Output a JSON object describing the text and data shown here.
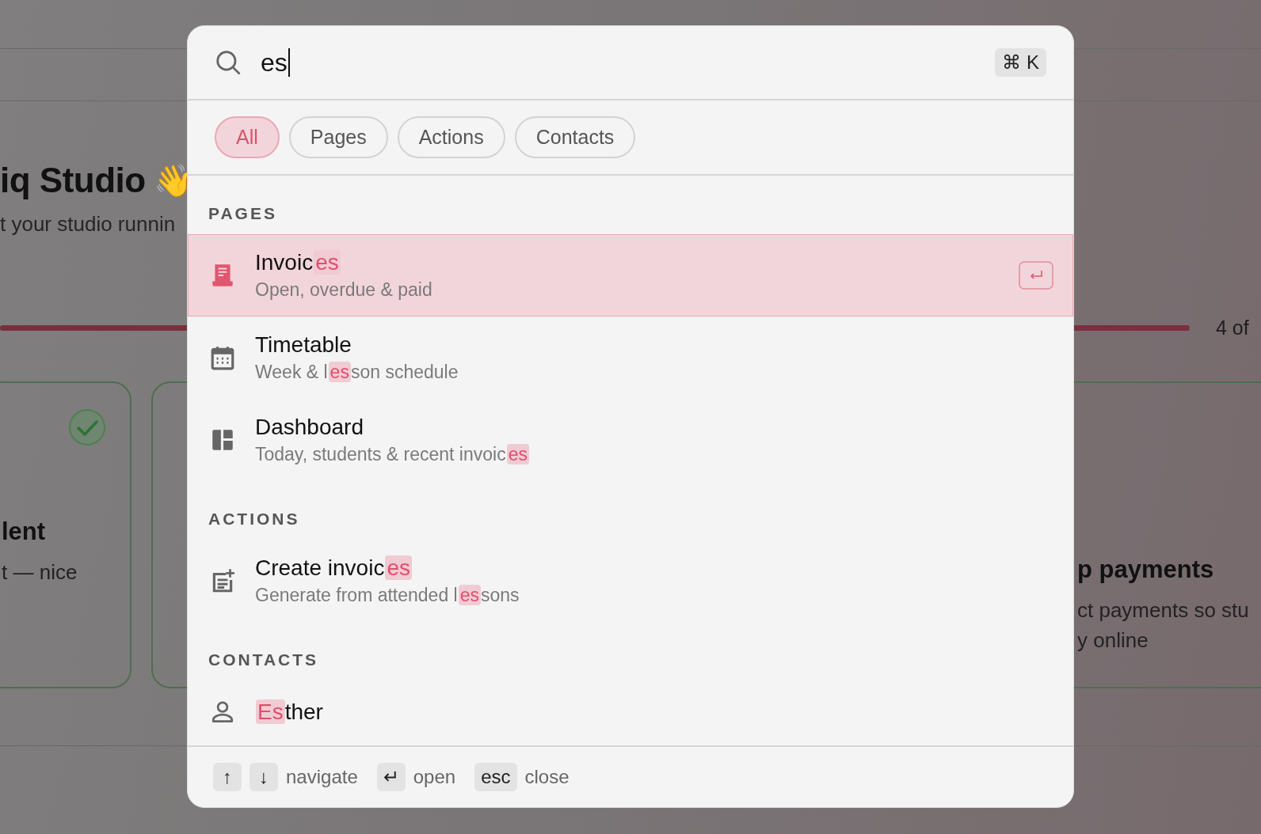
{
  "background": {
    "heading": "iq Studio",
    "heading_emoji": "👋",
    "subtitle": "t your studio runnin",
    "progress": {
      "level": 1,
      "reading": "4 of"
    },
    "cards": [
      {
        "title": "lent",
        "text": "t — nice",
        "done": true
      },
      {
        "title": "p payments",
        "lines": [
          "ct payments so stu",
          "y online"
        ]
      }
    ]
  },
  "palette": {
    "query": "es",
    "shortcut": "⌘ K",
    "filters": [
      {
        "label": "All",
        "selected": true
      },
      {
        "label": "Pages",
        "selected": false
      },
      {
        "label": "Actions",
        "selected": false
      },
      {
        "label": "Contacts",
        "selected": false
      }
    ],
    "sections": [
      {
        "label": "PAGES",
        "items": [
          {
            "kind": "receipt",
            "selected": true,
            "title": [
              {
                "text": "Invoic",
                "match": false
              },
              {
                "text": "es",
                "match": true
              }
            ],
            "subtitle": [
              {
                "text": "Open, overdue & paid",
                "match": false
              }
            ]
          },
          {
            "kind": "calendar",
            "selected": false,
            "title": [
              {
                "text": "Timetable",
                "match": false
              }
            ],
            "subtitle": [
              {
                "text": "Week & l",
                "match": false
              },
              {
                "text": "es",
                "match": true
              },
              {
                "text": "son schedule",
                "match": false
              }
            ]
          },
          {
            "kind": "dashboard",
            "selected": false,
            "title": [
              {
                "text": "Dashboard",
                "match": false
              }
            ],
            "subtitle": [
              {
                "text": "Today, students & recent invoic",
                "match": false
              },
              {
                "text": "es",
                "match": true
              }
            ]
          }
        ]
      },
      {
        "label": "ACTIONS",
        "items": [
          {
            "kind": "action",
            "selected": false,
            "title": [
              {
                "text": "Create invoic",
                "match": false
              },
              {
                "text": "es",
                "match": true
              }
            ],
            "subtitle": [
              {
                "text": "Generate from attended l",
                "match": false
              },
              {
                "text": "es",
                "match": true
              },
              {
                "text": "sons",
                "match": false
              }
            ]
          }
        ]
      },
      {
        "label": "CONTACTS",
        "items": [
          {
            "kind": "contact",
            "selected": false,
            "title": [
              {
                "text": "Es",
                "match": true
              },
              {
                "text": "ther",
                "match": false
              }
            ]
          }
        ]
      }
    ],
    "footer": [
      {
        "keys": [
          "↑",
          "↓"
        ],
        "label": "navigate"
      },
      {
        "keys": [
          "↵"
        ],
        "label": "open"
      },
      {
        "keys": [
          "esc"
        ],
        "label": "close"
      }
    ]
  }
}
